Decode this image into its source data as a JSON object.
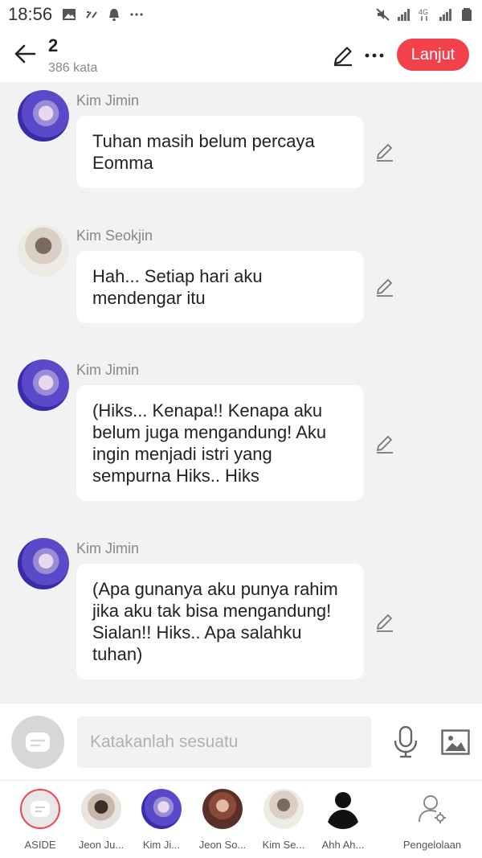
{
  "status_bar": {
    "time": "18:56"
  },
  "header": {
    "title": "2",
    "subtitle": "386 kata",
    "next_label": "Lanjut",
    "accent": "#f2414b"
  },
  "messages": [
    {
      "sender": "Kim Jimin",
      "text": "Tuhan masih belum percaya Eomma"
    },
    {
      "sender": "Kim Seokjin",
      "text": "Hah... Setiap hari aku mendengar itu"
    },
    {
      "sender": "Kim Jimin",
      "text": "(Hiks... Kenapa!! Kenapa aku belum juga mengandung! Aku ingin menjadi istri yang sempurna Hiks.. Hiks"
    },
    {
      "sender": "Kim Jimin",
      "text": "(Apa gunanya aku punya rahim jika aku tak bisa mengandung! Sialan!! Hiks.. Apa salahku tuhan)"
    }
  ],
  "input": {
    "placeholder": "Katakanlah sesuatu"
  },
  "characters": [
    {
      "label": "ASIDE"
    },
    {
      "label": "Jeon Ju..."
    },
    {
      "label": "Kim Ji..."
    },
    {
      "label": "Jeon So..."
    },
    {
      "label": "Kim Se..."
    },
    {
      "label": "Ahh Ah..."
    },
    {
      "label": "Pengelolaan"
    }
  ]
}
